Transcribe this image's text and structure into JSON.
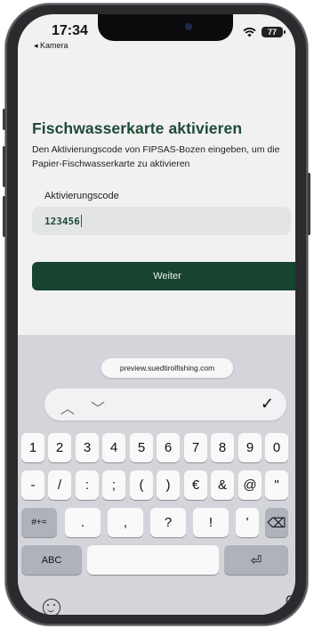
{
  "status": {
    "time": "17:34",
    "back_label": "◂ Kamera",
    "battery": "77"
  },
  "page": {
    "title": "Fischwasserkarte aktivieren",
    "description": "Den Aktivierungscode von FIPSAS-Bozen eingeben, um die Papier-Fischwasserkarte zu aktivieren",
    "field_label": "Aktivierungscode",
    "field_value": "123456",
    "button_label": "Weiter"
  },
  "browser": {
    "url": "preview.suedtirolfishing.com"
  },
  "accessory": {
    "prev": "︿",
    "next": "﹀",
    "done": "✓"
  },
  "keyboard": {
    "row1": [
      "1",
      "2",
      "3",
      "4",
      "5",
      "6",
      "7",
      "8",
      "9",
      "0"
    ],
    "row2": [
      "-",
      "/",
      ":",
      ";",
      "(",
      ")",
      "€",
      "&",
      "@",
      "\""
    ],
    "row3_mode": "#+=",
    "row3": [
      ".",
      ",",
      "?",
      "!",
      "'"
    ],
    "backspace": "⌫",
    "abc": "ABC",
    "return": "⏎"
  },
  "colors": {
    "brand_green": "#17432f",
    "title_green": "#1f4a36"
  }
}
